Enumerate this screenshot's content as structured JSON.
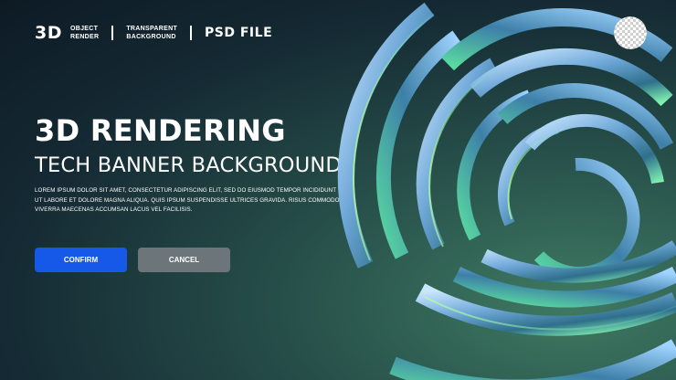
{
  "header": {
    "mark": "3D",
    "object_line1": "OBJECT",
    "object_line2": "RENDER",
    "transparent_line1": "TRANSPARENT",
    "transparent_line2": "BACKGROUND",
    "file_type": "PSD FILE"
  },
  "hero": {
    "title": "3D RENDERING",
    "subtitle": "TECH BANNER BACKGROUND",
    "body": "LOREM IPSUM DOLOR SIT AMET, CONSECTETUR ADIPISCING ELIT, SED DO EIUSMOD TEMPOR INCIDIDUNT UT LABORE ET DOLORE MAGNA ALIQUA. QUIS IPSUM SUSPENDISSE ULTRICES GRAVIDA. RISUS COMMODO VIVERRA MAECENAS ACCUMSAN LACUS VEL FACILISIS."
  },
  "buttons": {
    "confirm": "CONFIRM",
    "cancel": "CANCEL"
  },
  "colors": {
    "confirm": "#1659e8",
    "cancel": "#6b757a",
    "background_dark": "#0d1a24",
    "background_green": "#3f7a62"
  },
  "icons": {
    "transparency": "checkerboard-icon",
    "artwork": "3d-concentric-rings"
  }
}
